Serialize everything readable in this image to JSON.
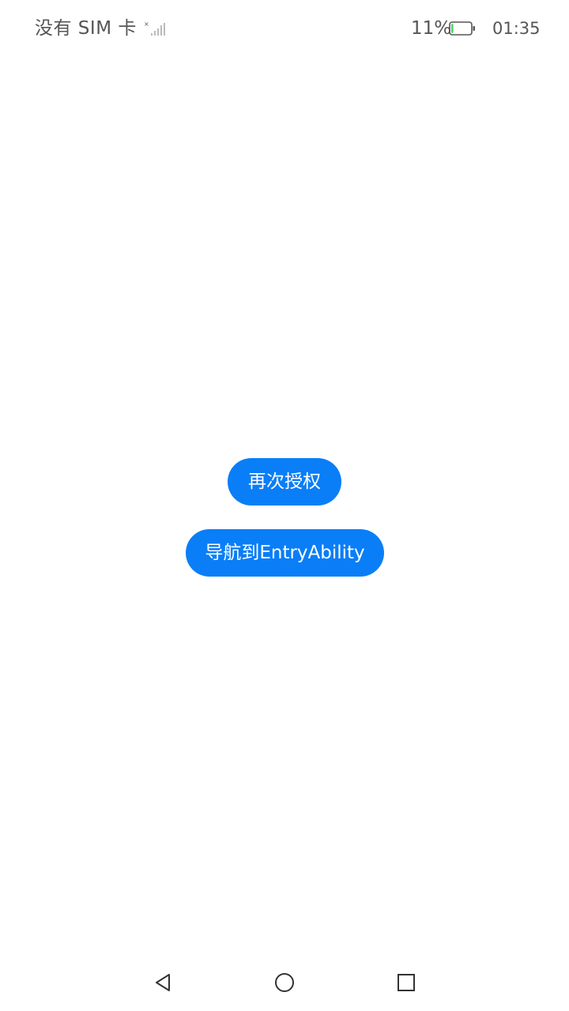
{
  "status_bar": {
    "carrier": "没有 SIM 卡",
    "battery_percent": "11%",
    "battery_level": 0.11,
    "time": "01:35",
    "signal_icon": "no-signal-icon",
    "battery_icon": "battery-low-icon"
  },
  "main": {
    "reauthorize_label": "再次授权",
    "navigate_label": "导航到EntryAbility"
  },
  "nav_bar": {
    "back_icon": "back-triangle-icon",
    "home_icon": "home-circle-icon",
    "recent_icon": "recent-square-icon"
  },
  "colors": {
    "accent": "#0a7ef7",
    "background": "#ffffff",
    "status_text": "#555555",
    "battery_fill": "#4cd964"
  }
}
